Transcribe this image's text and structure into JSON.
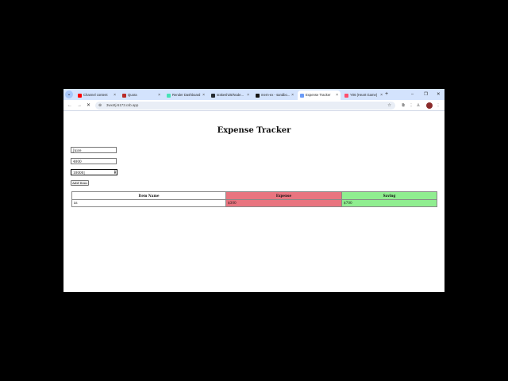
{
  "browser": {
    "tabs": [
      {
        "label": "Channel content",
        "color": "#ff0000",
        "active": false
      },
      {
        "label": "Quora",
        "color": "#b92b27",
        "active": false
      },
      {
        "label": "Render Dashboard",
        "color": "#46e3b7",
        "active": false
      },
      {
        "label": "srakesh25/Node...",
        "color": "#24292f",
        "active": false
      },
      {
        "label": "mern-ex - sandbo...",
        "color": "#151515",
        "active": false
      },
      {
        "label": "Expense Tracker",
        "color": "#6b9bf7",
        "active": true
      },
      {
        "label": "Y06 (Heart Game)",
        "color": "#ff4d6d",
        "active": false
      }
    ],
    "new_tab_label": "+",
    "url": "3wx4tj-5173.csb.app"
  },
  "page": {
    "title": "Expense Tracker",
    "form": {
      "item_name_value": "Juice",
      "expense_value": "4000",
      "income_value": "10000",
      "add_button_label": "Add Item"
    },
    "table": {
      "headers": [
        "Item Name",
        "Expense",
        "Saving"
      ],
      "rows": [
        [
          "xs",
          "$300",
          "$700"
        ]
      ]
    }
  },
  "colors": {
    "expense_bg": "#e9747f",
    "saving_bg": "#90ee90",
    "tabbar_bg": "#d3e3fd"
  }
}
